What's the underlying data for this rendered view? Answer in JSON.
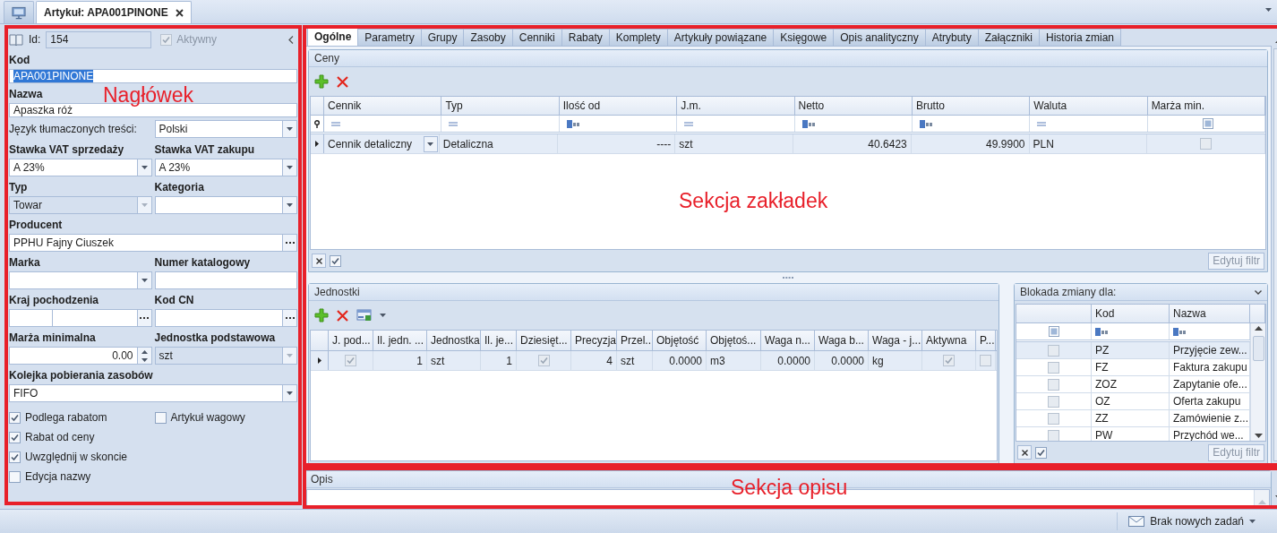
{
  "top_tabs": [
    {
      "kind": "icon",
      "selected": false
    },
    {
      "kind": "document",
      "label": "Artykuł: APA001PINONE",
      "selected": true
    }
  ],
  "header_panel": {
    "id_label": "Id:",
    "id_value": "154",
    "active": {
      "label": "Aktywny",
      "checked": true,
      "disabled": true
    },
    "rows": [
      {
        "fields": [
          {
            "kind": "text",
            "label": "Kod",
            "value": "APA001PINONE",
            "highlighted": true,
            "disabled": false
          }
        ]
      },
      {
        "fields": [
          {
            "kind": "text",
            "label": "Nazwa",
            "value": "Apaszka róż",
            "highlighted": false,
            "disabled": false
          }
        ]
      },
      {
        "fields": [
          {
            "kind": "inline_combo",
            "label": "Język tłumaczonych treści:",
            "value": "Polski",
            "highlighted": false,
            "disabled": false
          }
        ]
      },
      {
        "fields": [
          {
            "kind": "combo",
            "label": "Stawka VAT sprzedaży",
            "value": "A 23%",
            "highlighted": false,
            "disabled": false
          },
          {
            "kind": "combo",
            "label": "Stawka VAT zakupu",
            "value": "A 23%",
            "highlighted": false,
            "disabled": false
          }
        ]
      },
      {
        "fields": [
          {
            "kind": "combo",
            "label": "Typ",
            "value": "Towar",
            "highlighted": false,
            "disabled": true
          },
          {
            "kind": "combo",
            "label": "Kategoria",
            "disabled": false
          }
        ]
      },
      {
        "fields": [
          {
            "kind": "lookup",
            "label": "Producent",
            "value": "PPHU Fajny Ciuszek",
            "highlighted": false,
            "disabled": false
          }
        ]
      },
      {
        "fields": [
          {
            "kind": "combo",
            "label": "Marka",
            "disabled": false
          },
          {
            "kind": "text",
            "label": "Numer katalogowy",
            "disabled": false
          }
        ]
      },
      {
        "fields": [
          {
            "kind": "country",
            "label": "Kraj pochodzenia",
            "disabled": false
          },
          {
            "kind": "lookup",
            "label": "Kod CN",
            "disabled": false
          }
        ]
      },
      {
        "fields": [
          {
            "kind": "spin",
            "label": "Marża minimalna",
            "value": "0.00",
            "highlighted": false,
            "disabled": false
          },
          {
            "kind": "combo",
            "label": "Jednostka podstawowa",
            "value": "szt",
            "highlighted": false,
            "disabled": true
          }
        ]
      },
      {
        "fields": [
          {
            "kind": "combo",
            "label": "Kolejka pobierania zasobów",
            "value": "FIFO",
            "highlighted": false,
            "disabled": false
          }
        ]
      }
    ],
    "checkbox_rows": [
      [
        {
          "label": "Podlega rabatom",
          "checked": true
        },
        {
          "label": "Artykuł wagowy",
          "checked": false
        }
      ],
      [
        {
          "label": "Rabat od ceny",
          "checked": true
        }
      ],
      [
        {
          "label": "Uwzględnij w skoncie",
          "checked": true
        }
      ],
      [
        {
          "label": "Edycja nazwy",
          "checked": false
        }
      ]
    ]
  },
  "tabs": [
    {
      "label": "Ogólne",
      "selected": true
    },
    {
      "label": "Parametry",
      "selected": false
    },
    {
      "label": "Grupy",
      "selected": false
    },
    {
      "label": "Zasoby",
      "selected": false
    },
    {
      "label": "Cenniki",
      "selected": false
    },
    {
      "label": "Rabaty",
      "selected": false
    },
    {
      "label": "Komplety",
      "selected": false
    },
    {
      "label": "Artykuły powiązane",
      "selected": false
    },
    {
      "label": "Księgowe",
      "selected": false
    },
    {
      "label": "Opis analityczny",
      "selected": false
    },
    {
      "label": "Atrybuty",
      "selected": false
    },
    {
      "label": "Załączniki",
      "selected": false
    },
    {
      "label": "Historia zmian",
      "selected": false
    }
  ],
  "prices": {
    "title": "Ceny",
    "columns": [
      {
        "label": "Cennik",
        "kind": "eq"
      },
      {
        "label": "Typ",
        "kind": "eq"
      },
      {
        "label": "Ilość od",
        "kind": "abc"
      },
      {
        "label": "J.m.",
        "kind": "eq"
      },
      {
        "label": "Netto",
        "kind": "abc"
      },
      {
        "label": "Brutto",
        "kind": "abc"
      },
      {
        "label": "Waluta",
        "kind": "eq"
      },
      {
        "label": "Marża min.",
        "kind": "check"
      }
    ],
    "rows": [
      {
        "selected": true,
        "cells": [
          {
            "kind": "combo",
            "text": "Cennik detaliczny"
          },
          {
            "kind": "text",
            "text": "Detaliczna"
          },
          {
            "kind": "number",
            "text": "----"
          },
          {
            "kind": "text",
            "text": "szt"
          },
          {
            "kind": "number",
            "text": "40.6423"
          },
          {
            "kind": "number",
            "text": "49.9900"
          },
          {
            "kind": "text",
            "text": "PLN"
          },
          {
            "kind": "check",
            "checked": false
          }
        ]
      }
    ],
    "footer": {
      "filter_enabled": true,
      "button": "Edytuj filtr"
    }
  },
  "units": {
    "title": "Jednostki",
    "columns": [
      "J. pod...",
      "Il. jedn. ...",
      "Jednostka",
      "Il. je...",
      "Dziesięt...",
      "Precyzja",
      "Przel...",
      "Objętość",
      "Objętoś...",
      "Waga n...",
      "Waga b...",
      "Waga - j...",
      "Aktywna",
      "P..."
    ],
    "rows": [
      {
        "selected": true,
        "cells": [
          {
            "kind": "check",
            "checked": true
          },
          {
            "kind": "number",
            "text": "1"
          },
          {
            "kind": "text",
            "text": "szt"
          },
          {
            "kind": "number",
            "text": "1"
          },
          {
            "kind": "check",
            "checked": true
          },
          {
            "kind": "number",
            "text": "4"
          },
          {
            "kind": "text",
            "text": "szt"
          },
          {
            "kind": "number",
            "text": "0.0000"
          },
          {
            "kind": "text",
            "text": "m3"
          },
          {
            "kind": "number",
            "text": "0.0000"
          },
          {
            "kind": "number",
            "text": "0.0000"
          },
          {
            "kind": "text",
            "text": "kg"
          },
          {
            "kind": "check",
            "checked": true
          },
          {
            "kind": "check",
            "checked": false
          }
        ]
      }
    ]
  },
  "lock": {
    "title": "Blokada zmiany dla:",
    "columns": [
      "Kod",
      "Nazwa"
    ],
    "rows": [
      {
        "code": "PZ",
        "name": "Przyjęcie zew...",
        "checked": false,
        "selected": true
      },
      {
        "code": "FZ",
        "name": "Faktura zakupu",
        "checked": false,
        "selected": false
      },
      {
        "code": "ZOZ",
        "name": "Zapytanie ofe...",
        "checked": false,
        "selected": false
      },
      {
        "code": "OZ",
        "name": "Oferta zakupu",
        "checked": false,
        "selected": false
      },
      {
        "code": "ZZ",
        "name": "Zamówienie z...",
        "checked": false,
        "selected": false
      },
      {
        "code": "PW",
        "name": "Przychód we...",
        "checked": false,
        "selected": false
      }
    ],
    "footer": {
      "filter_enabled": true,
      "button": "Edytuj filtr"
    }
  },
  "description": {
    "title": "Opis"
  },
  "status_bar": {
    "tasks": "Brak nowych zadań"
  },
  "annotations": [
    {
      "label": "Nagłówek"
    },
    {
      "label": "Sekcja zakładek"
    },
    {
      "label": "Sekcja opisu"
    }
  ]
}
